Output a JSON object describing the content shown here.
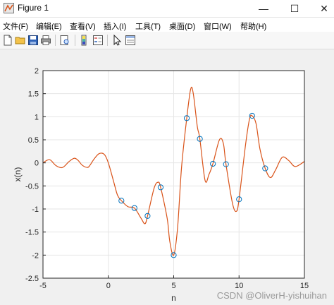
{
  "window": {
    "title": "Figure 1",
    "minimize_glyph": "—",
    "maximize_glyph": "☐",
    "close_glyph": "✕"
  },
  "menu": {
    "items": [
      "文件(F)",
      "编辑(E)",
      "查看(V)",
      "插入(I)",
      "工具(T)",
      "桌面(D)",
      "窗口(W)",
      "帮助(H)"
    ]
  },
  "toolbar": {
    "icons": [
      "new-figure-icon",
      "open-file-icon",
      "save-icon",
      "print-icon",
      "print-preview-icon",
      "colorbar-icon",
      "legend-icon",
      "pointer-icon",
      "property-editor-icon"
    ]
  },
  "watermark": "CSDN @OliverH-yishuihan",
  "colors": {
    "line": "#d95319",
    "marker": "#0072bd",
    "axes_bg": "#ffffff",
    "figure_bg": "#f0f0f0",
    "grid": "#e6e6e6"
  },
  "chart_data": {
    "type": "line",
    "xlabel": "n",
    "ylabel": "x(n)",
    "xlim": [
      -5,
      15
    ],
    "ylim": [
      -2.5,
      2
    ],
    "xticks": [
      -5,
      0,
      5,
      10,
      15
    ],
    "yticks": [
      -2.5,
      -2,
      -1.5,
      -1,
      -0.5,
      0,
      0.5,
      1,
      1.5,
      2
    ],
    "ytick_labels": [
      "-2.5",
      "-2",
      "-1.5",
      "-1",
      "-0.5",
      "0",
      "0.5",
      "1",
      "1.5",
      "2"
    ],
    "grid": true,
    "series": [
      {
        "kind": "samples",
        "marker": "circle",
        "x": [
          1,
          2,
          3,
          4,
          5,
          6,
          7,
          8,
          9,
          10,
          11,
          12
        ],
        "y": [
          -0.82,
          -0.98,
          -1.15,
          -0.53,
          -2.0,
          0.97,
          0.52,
          -0.02,
          -0.03,
          -0.79,
          1.02,
          -0.12
        ]
      },
      {
        "kind": "interpolated",
        "x": [
          -5,
          -4.5,
          -4,
          -3.5,
          -3,
          -2.6,
          -2.3,
          -2,
          -1.6,
          -1.4,
          -1.1,
          -0.7,
          -0.3,
          0,
          0.4,
          0.7,
          1,
          1.5,
          2,
          2.5,
          2.8,
          3,
          3.5,
          3.8,
          4,
          4.5,
          4.7,
          5,
          5.3,
          5.6,
          6,
          6.3,
          6.5,
          6.8,
          7,
          7.4,
          7.7,
          8,
          8.5,
          8.8,
          9,
          9.5,
          9.8,
          10,
          10.5,
          10.8,
          11,
          11.3,
          11.6,
          12,
          12.4,
          12.8,
          13.3,
          13.8,
          14.3,
          15
        ],
        "y": [
          0,
          0.07,
          -0.06,
          -0.1,
          0.03,
          0.1,
          0.05,
          -0.05,
          -0.1,
          -0.05,
          0.08,
          0.2,
          0.18,
          0,
          -0.4,
          -0.7,
          -0.82,
          -0.95,
          -0.98,
          -1.2,
          -1.32,
          -1.15,
          -0.55,
          -0.42,
          -0.53,
          -1.2,
          -1.7,
          -2.0,
          -1.4,
          -0.1,
          0.97,
          1.6,
          1.5,
          0.8,
          0.52,
          -0.38,
          -0.25,
          -0.02,
          0.5,
          0.42,
          -0.03,
          -0.88,
          -1.05,
          -0.79,
          0.4,
          0.95,
          1.02,
          0.85,
          0.3,
          -0.12,
          -0.32,
          -0.15,
          0.12,
          0.05,
          -0.08,
          0.03
        ]
      }
    ]
  }
}
